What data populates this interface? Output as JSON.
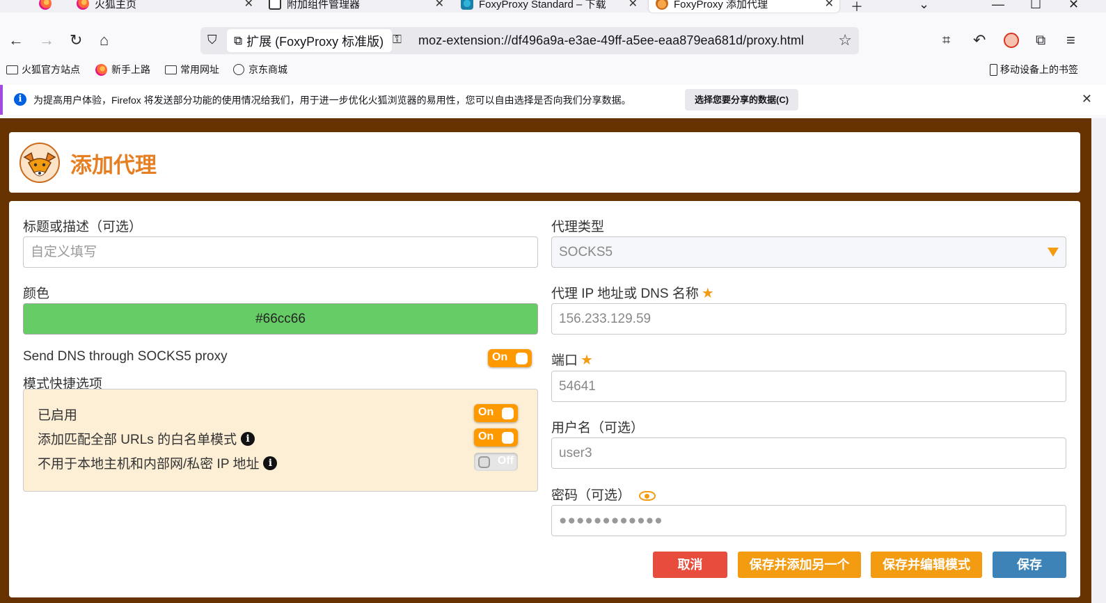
{
  "tabs": [
    {
      "label": "",
      "favicon": "firefox-icon"
    },
    {
      "label": "火狐主页",
      "favicon": "firefox-icon"
    },
    {
      "label": "附加组件管理器",
      "favicon": "puzzle-icon"
    },
    {
      "label": "FoxyProxy Standard – 下载",
      "favicon": "foxyproxy-icon"
    },
    {
      "label": "FoxyProxy 添加代理",
      "favicon": "foxyproxy-icon",
      "active": true
    }
  ],
  "nav": {
    "extension_label": "扩展 (FoxyProxy 标准版)",
    "url": "moz-extension://df496a9a-e3ae-49ff-a5ee-eaa879ea681d/proxy.html"
  },
  "bookmarks": {
    "items": [
      "火狐官方站点",
      "新手上路",
      "常用网址",
      "京东商城"
    ],
    "mobile": "移动设备上的书签"
  },
  "notice": {
    "message": "为提高用户体验，Firefox 将发送部分功能的使用情况给我们，用于进一步优化火狐浏览器的易用性，您可以自由选择是否向我们分享数据。",
    "button": "选择您要分享的数据(C)"
  },
  "page": {
    "title": "添加代理",
    "accent_color": "#e67e22",
    "background_color": "#663300"
  },
  "form": {
    "title_label": "标题或描述（可选）",
    "title_placeholder": "自定义填写",
    "color_label": "颜色",
    "color_value": "#66cc66",
    "send_dns_label": "Send DNS through SOCKS5 proxy",
    "send_dns_toggle": "On",
    "pattern_label": "模式快捷选项",
    "pattern_enabled_label": "已启用",
    "pattern_enabled_toggle": "On",
    "pattern_whitelist_label": "添加匹配全部 URLs 的白名单模式",
    "pattern_whitelist_toggle": "On",
    "pattern_local_label": "不用于本地主机和内部网/私密 IP 地址",
    "pattern_local_toggle": "Off",
    "proxy_type_label": "代理类型",
    "proxy_type_value": "SOCKS5",
    "host_label": "代理 IP 地址或 DNS 名称",
    "host_value": "156.233.129.59",
    "port_label": "端口",
    "port_value": "54641",
    "username_label": "用户名（可选）",
    "username_value": "user3",
    "password_label": "密码（可选）",
    "password_value": "●●●●●●●●●●●●"
  },
  "buttons": {
    "cancel": "取消",
    "save_add_another": "保存并添加另一个",
    "save_edit_patterns": "保存并编辑模式",
    "save": "保存"
  }
}
